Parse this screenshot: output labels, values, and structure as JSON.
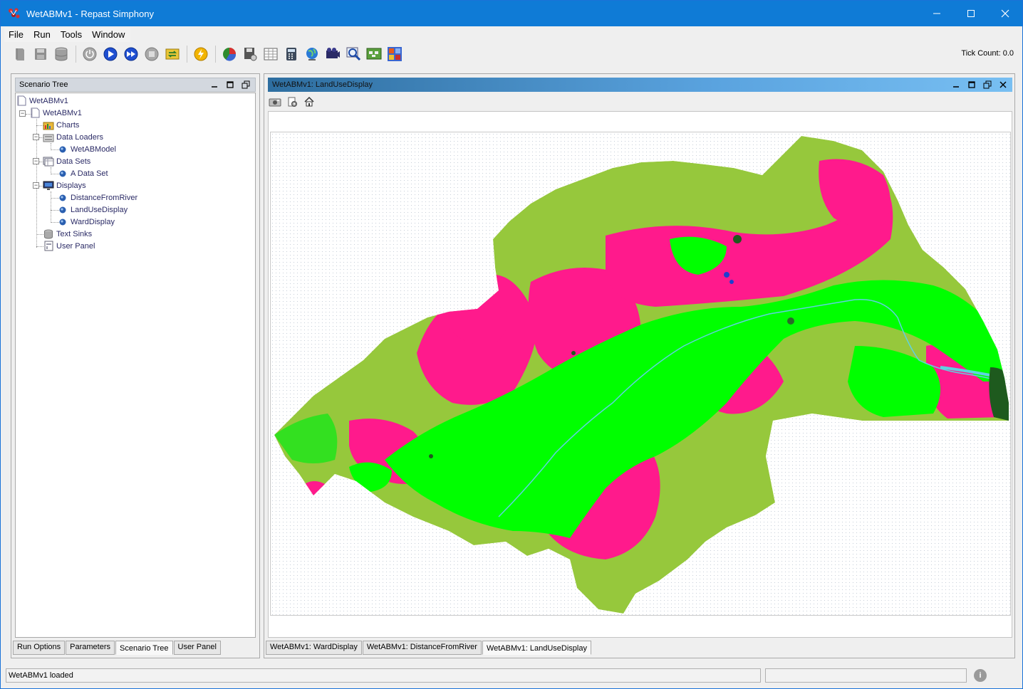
{
  "window": {
    "title": "WetABMv1 - Repast Simphony",
    "controls": [
      "minimize",
      "maximize",
      "close"
    ]
  },
  "menu": [
    "File",
    "Run",
    "Tools",
    "Window"
  ],
  "toolbar": {
    "icons": [
      "new-icon",
      "save-icon",
      "database-icon",
      "init-icon",
      "run-icon",
      "step-icon",
      "stop-icon",
      "reset-icon",
      "flash-icon",
      "pie-chart-icon",
      "save-settings-icon",
      "table-icon",
      "calculator-icon",
      "globe-icon",
      "movie-icon",
      "zoom-icon",
      "image-export-icon",
      "grid-icon"
    ],
    "tick_count": "Tick Count: 0.0"
  },
  "left_panel": {
    "title": "Scenario Tree",
    "tree": {
      "root": "WetABMv1",
      "model": "WetABMv1",
      "charts": "Charts",
      "data_loaders": "Data Loaders",
      "data_loader_item": "WetABModel",
      "data_sets": "Data Sets",
      "data_set_item": "A Data Set",
      "displays": "Displays",
      "display_items": [
        "DistanceFromRiver",
        "LandUseDisplay",
        "WardDisplay"
      ],
      "text_sinks": "Text Sinks",
      "user_panel": "User Panel"
    },
    "tabs": [
      "Run Options",
      "Parameters",
      "Scenario Tree",
      "User Panel"
    ],
    "active_tab": "Scenario Tree"
  },
  "right_panel": {
    "title": "WetABMv1: LandUseDisplay",
    "tabs": [
      "WetABMv1: WardDisplay",
      "WetABMv1: DistanceFromRiver",
      "WetABMv1: LandUseDisplay"
    ],
    "active_tab": "WetABMv1: LandUseDisplay",
    "map_colors": {
      "grassland": "#96c83c",
      "forest": "#00ff00",
      "urban": "#ff1a8c",
      "water": "#5fd2e0",
      "wetland": "#1e5a1e"
    }
  },
  "status": {
    "message": "WetABMv1 loaded"
  }
}
